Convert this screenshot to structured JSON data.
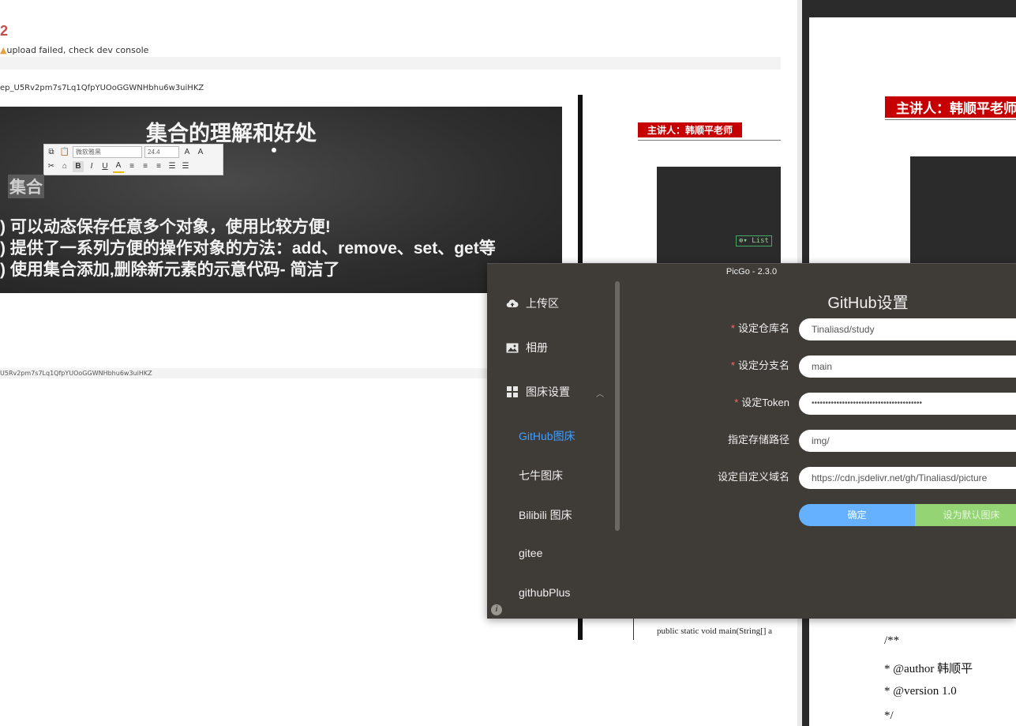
{
  "document": {
    "heading": "2",
    "upload_warning": "upload failed, check dev console",
    "image_path": "ep_U5Rv2pm7s7Lq1QfpYUOoGGWNHbhu6w3uiHKZ",
    "image_path_bottom": "U5Rv2pm7s7Lq1QfpYUOoGGWNHbhu6w3uiHKZ"
  },
  "slide": {
    "title": "集合的理解和好处",
    "word": "集合",
    "lines": [
      ") 可以动态保存任意多个对象，使用比较方便!",
      ") 提供了一系列方便的操作对象的方法：add、remove、set、get等",
      ") 使用集合添加,删除新元素的示意代码- 简洁了"
    ],
    "toolbar": {
      "font": "微软雅黑",
      "size": "24.4"
    }
  },
  "pdf_preview": {
    "lecturer_label": "主讲人：韩顺平老师",
    "list_label": "List",
    "code_line": "public static void main(String[] a",
    "right_code": [
      "/**",
      " * @author  韩顺平",
      " * @version 1.0",
      " */"
    ]
  },
  "picgo": {
    "title": "PicGo - 2.3.0",
    "nav": [
      {
        "label": "上传区",
        "icon": "cloud-upload-icon"
      },
      {
        "label": "相册",
        "icon": "image-icon"
      },
      {
        "label": "图床设置",
        "icon": "grid-icon"
      }
    ],
    "sub_nav": [
      "GitHub图床",
      "七牛图床",
      "Bilibili 图床",
      "gitee",
      "githubPlus"
    ],
    "form": {
      "title": "GitHub设置",
      "fields": [
        {
          "label": "设定仓库名",
          "required": "*",
          "value": "Tinaliasd/study"
        },
        {
          "label": "设定分支名",
          "required": "*",
          "value": "main"
        },
        {
          "label": "设定Token",
          "required": "*",
          "value": "••••••••••••••••••••••••••••••••••••••••"
        },
        {
          "label": "指定存储路径",
          "required": "",
          "value": "img/"
        },
        {
          "label": "设定自定义域名",
          "required": "",
          "value": "https://cdn.jsdelivr.net/gh/Tinaliasd/picture"
        }
      ],
      "confirm_label": "确定",
      "default_label": "设为默认图床"
    },
    "colors": {
      "accent": "#409eff",
      "bg": "#3f3b37",
      "required": "#f56c6c",
      "green": "#95d475"
    }
  }
}
